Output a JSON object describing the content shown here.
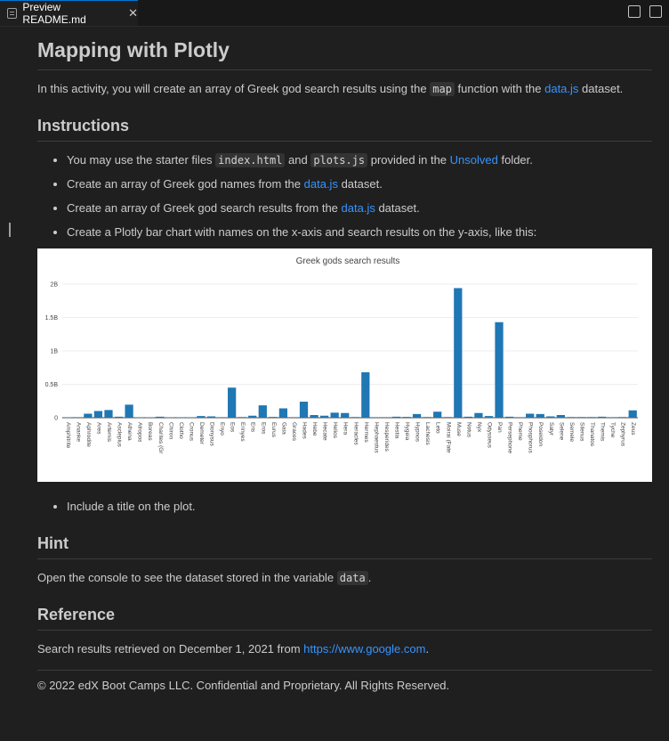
{
  "tab": {
    "title": "Preview README.md",
    "close": "✕"
  },
  "doc": {
    "title": "Mapping with Plotly",
    "intro": {
      "pre": "In this activity, you will create an array of Greek god search results using the ",
      "code": "map",
      "mid": " function with the ",
      "link": "data.js",
      "post": " dataset."
    },
    "instructions_heading": "Instructions",
    "items": [
      {
        "t1": "You may use the starter files ",
        "c1": "index.html",
        "t2": " and ",
        "c2": "plots.js",
        "t3": " provided in the ",
        "link": "Unsolved",
        "t4": " folder."
      },
      {
        "t1": "Create an array of Greek god names from the ",
        "link": "data.js",
        "t2": " dataset."
      },
      {
        "t1": "Create an array of Greek god search results from the ",
        "link": "data.js",
        "t2": " dataset."
      },
      {
        "t1": "Create a Plotly bar chart with names on the x-axis and search results on the y-axis, like this:"
      }
    ],
    "last_item": "Include a title on the plot.",
    "hint_heading": "Hint",
    "hint": {
      "pre": "Open the console to see the dataset stored in the variable ",
      "code": "data",
      "post": "."
    },
    "reference_heading": "Reference",
    "reference": {
      "pre": "Search results retrieved on December 1, 2021 from ",
      "link": "https://www.google.com",
      "post": "."
    },
    "footer": "© 2022 edX Boot Camps LLC. Confidential and Proprietary. All Rights Reserved."
  },
  "chart_data": {
    "type": "bar",
    "title": "Greek gods search results",
    "ylim": [
      0,
      2000000000
    ],
    "yticks": [
      0,
      500000000,
      1000000000,
      1500000000,
      2000000000
    ],
    "ytick_labels": [
      "0",
      "0.5B",
      "1B",
      "1.5B",
      "2B"
    ],
    "color": "#1f77b4",
    "categories": [
      "Amphitrite",
      "Ananke",
      "Aphrodite",
      "Ares",
      "Artemis",
      "Asclepius",
      "Athena",
      "Atropos",
      "Boreas",
      "Charites (Gr",
      "Chiron",
      "Clotho",
      "Cronus",
      "Demeter",
      "Dionysus",
      "Enyo",
      "Eos",
      "Erinyes",
      "Eris",
      "Eros",
      "Eurus",
      "Gaia",
      "Graces",
      "Hades",
      "Hebe",
      "Hecate",
      "Helios",
      "Hera",
      "Heracles",
      "Hermes",
      "Hephaestus",
      "Hesperides",
      "Hestia",
      "Hygeia",
      "Hypnos",
      "Lachesis",
      "Leto",
      "Moirai (Fate",
      "Muse",
      "Notus",
      "Nyx",
      "Odysseus",
      "Pan",
      "Persephone",
      "Pheme",
      "Phosphorus",
      "Poseidon",
      "Satyr",
      "Selene",
      "Semele",
      "Silenus",
      "Thanatos",
      "Themis",
      "Tyche",
      "Zephyrus",
      "Zeus"
    ],
    "values": [
      5000000,
      8000000,
      60000000,
      100000000,
      115000000,
      15000000,
      195000000,
      5000000,
      6000000,
      15000000,
      6000000,
      5000000,
      6000000,
      25000000,
      20000000,
      8000000,
      450000000,
      10000000,
      30000000,
      185000000,
      12000000,
      140000000,
      8000000,
      240000000,
      40000000,
      30000000,
      75000000,
      70000000,
      10000000,
      680000000,
      8000000,
      8000000,
      15000000,
      12000000,
      55000000,
      10000000,
      90000000,
      10000000,
      1940000000,
      15000000,
      70000000,
      25000000,
      1430000000,
      15000000,
      8000000,
      60000000,
      55000000,
      20000000,
      40000000,
      10000000,
      10000000,
      10000000,
      15000000,
      8000000,
      10000000,
      110000000
    ]
  }
}
